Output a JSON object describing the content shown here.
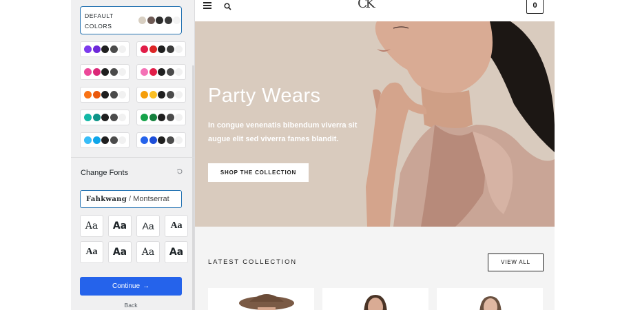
{
  "panel": {
    "default_colors": {
      "label": "DEFAULT COLORS",
      "swatches": [
        "#d8cfc2",
        "#6e5a55",
        "#2b2b2b",
        "#3a3a3a",
        "#f3f3f3"
      ]
    },
    "color_schemes": [
      [
        "#7c3aed",
        "#6d28d9",
        "#1f1f1f",
        "#4b4b4b",
        "#f1f1f1"
      ],
      [
        "#e11d48",
        "#dc2626",
        "#1f1f1f",
        "#3b3b3b",
        "#f1f1f1"
      ],
      [
        "#ec4899",
        "#db2777",
        "#1f1f1f",
        "#4b4b4b",
        "#f1f1f1"
      ],
      [
        "#f472b6",
        "#e11d48",
        "#1f1f1f",
        "#4b4b4b",
        "#f1f1f1"
      ],
      [
        "#f97316",
        "#ea580c",
        "#1f1f1f",
        "#4b4b4b",
        "#f1f1f1"
      ],
      [
        "#f59e0b",
        "#fbbf24",
        "#1f1f1f",
        "#4b4b4b",
        "#f1f1f1"
      ],
      [
        "#14b8a6",
        "#0d9488",
        "#1f1f1f",
        "#4b4b4b",
        "#f1f1f1"
      ],
      [
        "#16a34a",
        "#15803d",
        "#1f1f1f",
        "#4b4b4b",
        "#f1f1f1"
      ],
      [
        "#38bdf8",
        "#0ea5e9",
        "#1f1f1f",
        "#4b4b4b",
        "#f1f1f1"
      ],
      [
        "#2563eb",
        "#1d4ed8",
        "#1f1f1f",
        "#4b4b4b",
        "#f1f1f1"
      ]
    ],
    "fonts_title": "Change Fonts",
    "font_select": {
      "heading": "Fahkwang",
      "separator": " / ",
      "body": "Montserrat"
    },
    "font_sample": "Aa",
    "continue_label": "Continue",
    "back_label": "Back",
    "accent": "#2563eb"
  },
  "preview": {
    "logo": "CK",
    "cart_count": "0",
    "hero": {
      "title": "Party Wears",
      "text": "In congue venenatis bibendum viverra sit augue elit sed viverra fames blandit.",
      "button": "SHOP THE COLLECTION"
    },
    "latest": {
      "title": "LATEST COLLECTION",
      "button": "VIEW ALL"
    }
  }
}
